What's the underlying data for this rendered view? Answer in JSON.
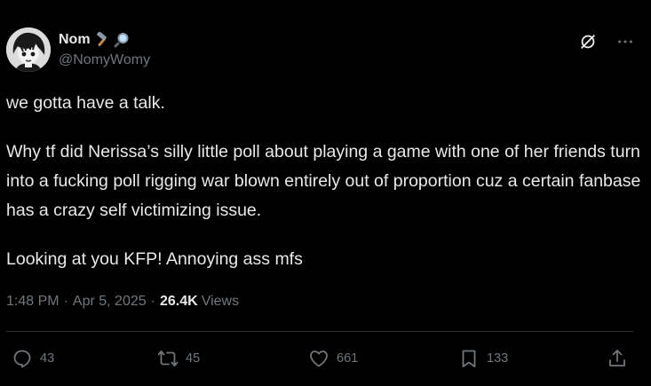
{
  "author": {
    "display_name": "Nom",
    "name_emojis": [
      "hammer-icon",
      "magnifying-glass-icon"
    ],
    "handle": "@NomyWomy"
  },
  "tweet": {
    "paragraphs": [
      "we gotta have a talk.",
      "Why tf did Nerissa’s silly little poll about playing a game with one of her friends turn into a fucking poll rigging war blown entirely out of proportion cuz a certain fanbase has a crazy self victimizing issue.",
      "Looking at you KFP! Annoying ass mfs"
    ]
  },
  "meta": {
    "time": "1:48 PM",
    "date": "Apr 5, 2025",
    "separator": "·",
    "views_count": "26.4K",
    "views_label": "Views"
  },
  "actions": {
    "replies": "43",
    "reposts": "45",
    "likes": "661",
    "bookmarks": "133"
  },
  "colors": {
    "background": "#000000",
    "text": "#e7e9ea",
    "secondary": "#71767b",
    "divider": "#2f3336"
  }
}
